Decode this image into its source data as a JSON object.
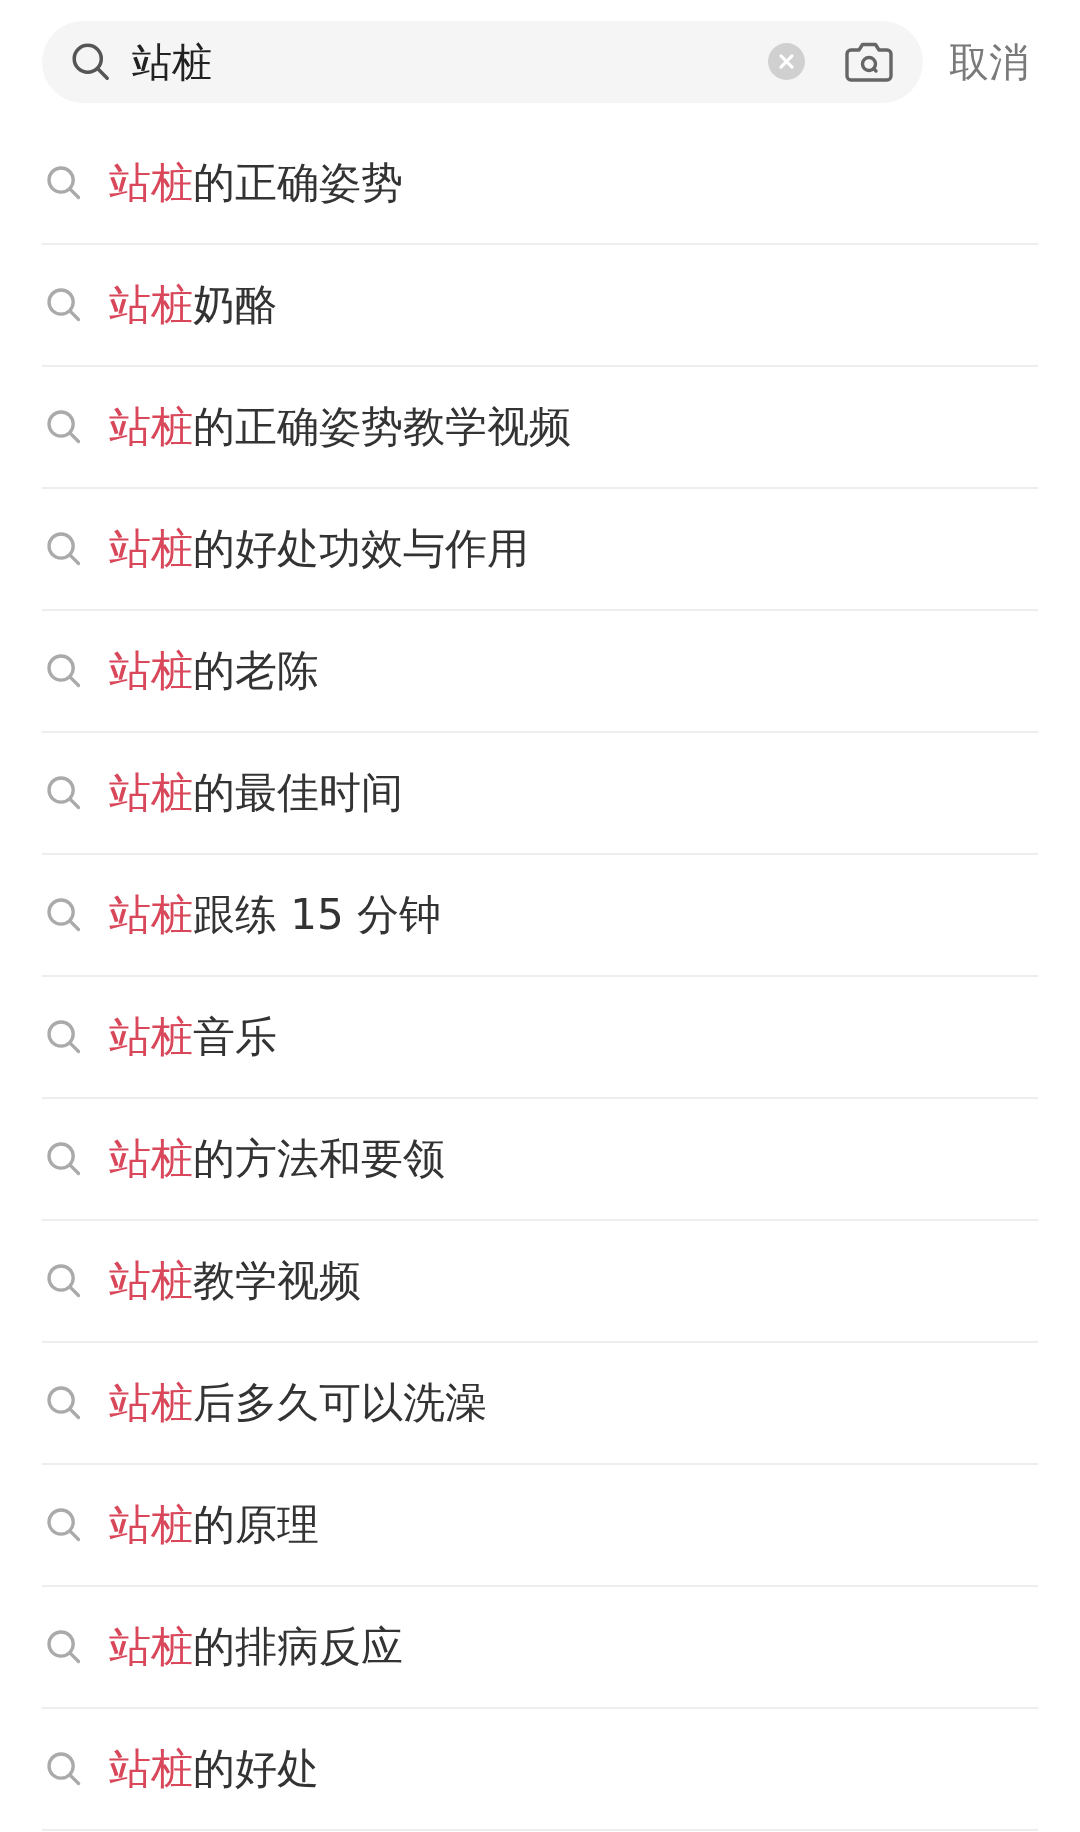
{
  "search": {
    "value": "站桩",
    "cancel": "取消"
  },
  "suggestions": [
    {
      "match": "站桩",
      "rest": "的正确姿势"
    },
    {
      "match": "站桩",
      "rest": "奶酪"
    },
    {
      "match": "站桩",
      "rest": "的正确姿势教学视频"
    },
    {
      "match": "站桩",
      "rest": "的好处功效与作用"
    },
    {
      "match": "站桩",
      "rest": "的老陈"
    },
    {
      "match": "站桩",
      "rest": "的最佳时间"
    },
    {
      "match": "站桩",
      "rest": "跟练 15 分钟"
    },
    {
      "match": "站桩",
      "rest": "音乐"
    },
    {
      "match": "站桩",
      "rest": "的方法和要领"
    },
    {
      "match": "站桩",
      "rest": "教学视频"
    },
    {
      "match": "站桩",
      "rest": "后多久可以洗澡"
    },
    {
      "match": "站桩",
      "rest": "的原理"
    },
    {
      "match": "站桩",
      "rest": "的排病反应"
    },
    {
      "match": "站桩",
      "rest": "的好处"
    }
  ]
}
